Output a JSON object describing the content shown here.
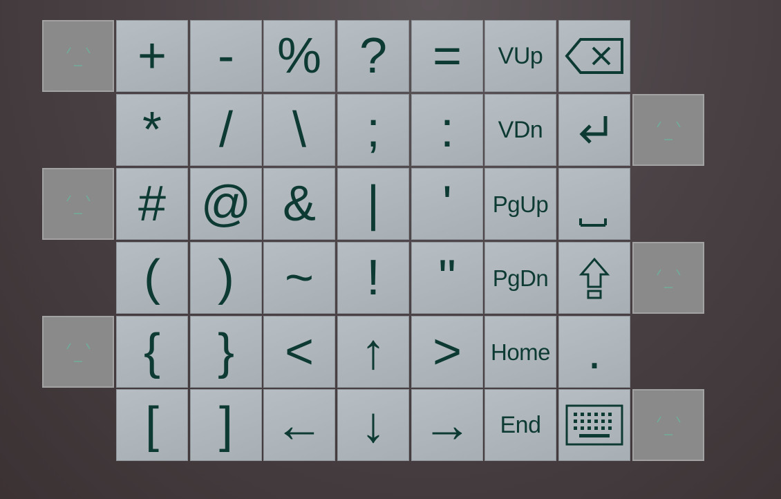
{
  "colors": {
    "background": "#453d40",
    "key_face": "#adb5bb",
    "key_text": "#0e3a34",
    "side_key": "#8a8a8a",
    "side_face_lines": "#6fae9c"
  },
  "keyboard": {
    "rows": [
      [
        "+",
        "-",
        "%",
        "?",
        "=",
        "VUp"
      ],
      [
        "*",
        "/",
        "\\",
        ";",
        ":",
        "VDn"
      ],
      [
        "#",
        "@",
        "&",
        "|",
        "'",
        "PgUp"
      ],
      [
        "(",
        ")",
        "~",
        "!",
        "\"",
        "PgDn"
      ],
      [
        "{",
        "}",
        "<",
        "↑",
        ">",
        "Home"
      ],
      [
        "[",
        "]",
        "←",
        "↓",
        "→",
        "End"
      ]
    ],
    "right_column": {
      "row0": "backspace-icon",
      "row1": "enter-icon",
      "row2": "space-icon",
      "row3": "shift-icon",
      "row4": ".",
      "row5": "keyboard-icon"
    },
    "side_keys": [
      "left-row0",
      "right-row1",
      "left-row2",
      "right-row3",
      "left-row4",
      "right-row5"
    ],
    "side_key_icon": "face-icon"
  }
}
